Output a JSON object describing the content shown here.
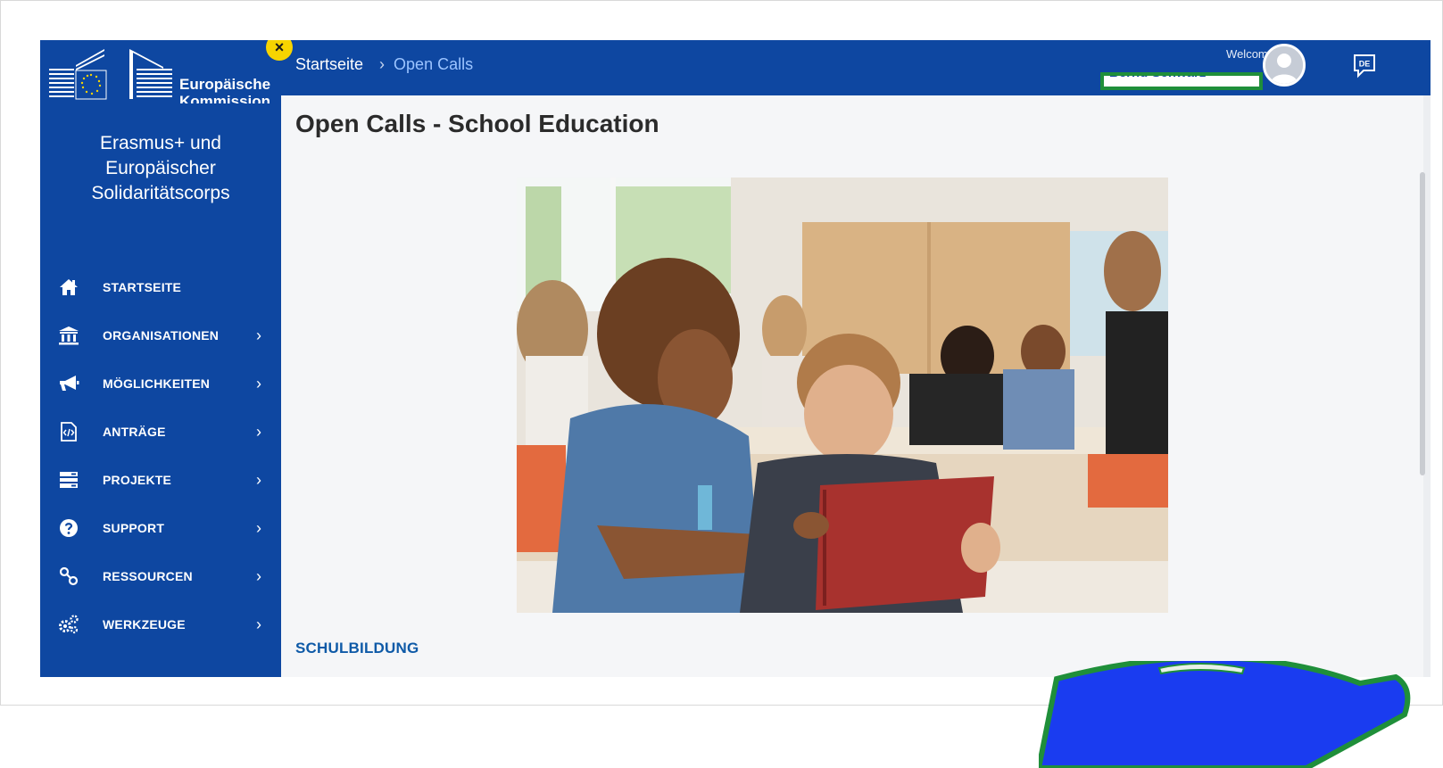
{
  "sidebar": {
    "logo_line1": "Europäische",
    "logo_line2": "Kommission",
    "close_label": "×",
    "program_title": "Erasmus+ und Europäischer Solidaritätscorps",
    "items": [
      {
        "label": "STARTSEITE",
        "icon": "home-icon",
        "has_submenu": false
      },
      {
        "label": "ORGANISATIONEN",
        "icon": "bank-icon",
        "has_submenu": true
      },
      {
        "label": "MÖGLICHKEITEN",
        "icon": "megaphone-icon",
        "has_submenu": true
      },
      {
        "label": "ANTRÄGE",
        "icon": "document-code-icon",
        "has_submenu": true
      },
      {
        "label": "PROJEKTE",
        "icon": "server-icon",
        "has_submenu": true
      },
      {
        "label": "SUPPORT",
        "icon": "question-icon",
        "has_submenu": true
      },
      {
        "label": "RESSOURCEN",
        "icon": "link-icon",
        "has_submenu": true
      },
      {
        "label": "WERKZEUGE",
        "icon": "gears-icon",
        "has_submenu": true
      }
    ],
    "chevron": "›"
  },
  "header": {
    "breadcrumb_home": "Startseite",
    "breadcrumb_sep": "›",
    "breadcrumb_current": "Open Calls",
    "welcome": "Welcome",
    "username": "Bernd Schwarz",
    "lang": "DE"
  },
  "main": {
    "title": "Open Calls - School Education",
    "section_label": "SCHULBILDUNG"
  },
  "colors": {
    "brand_blue": "#0e47a1",
    "link_blue": "#9cc4ff",
    "close_yellow": "#f7d400",
    "section_blue": "#0e5aa7"
  }
}
